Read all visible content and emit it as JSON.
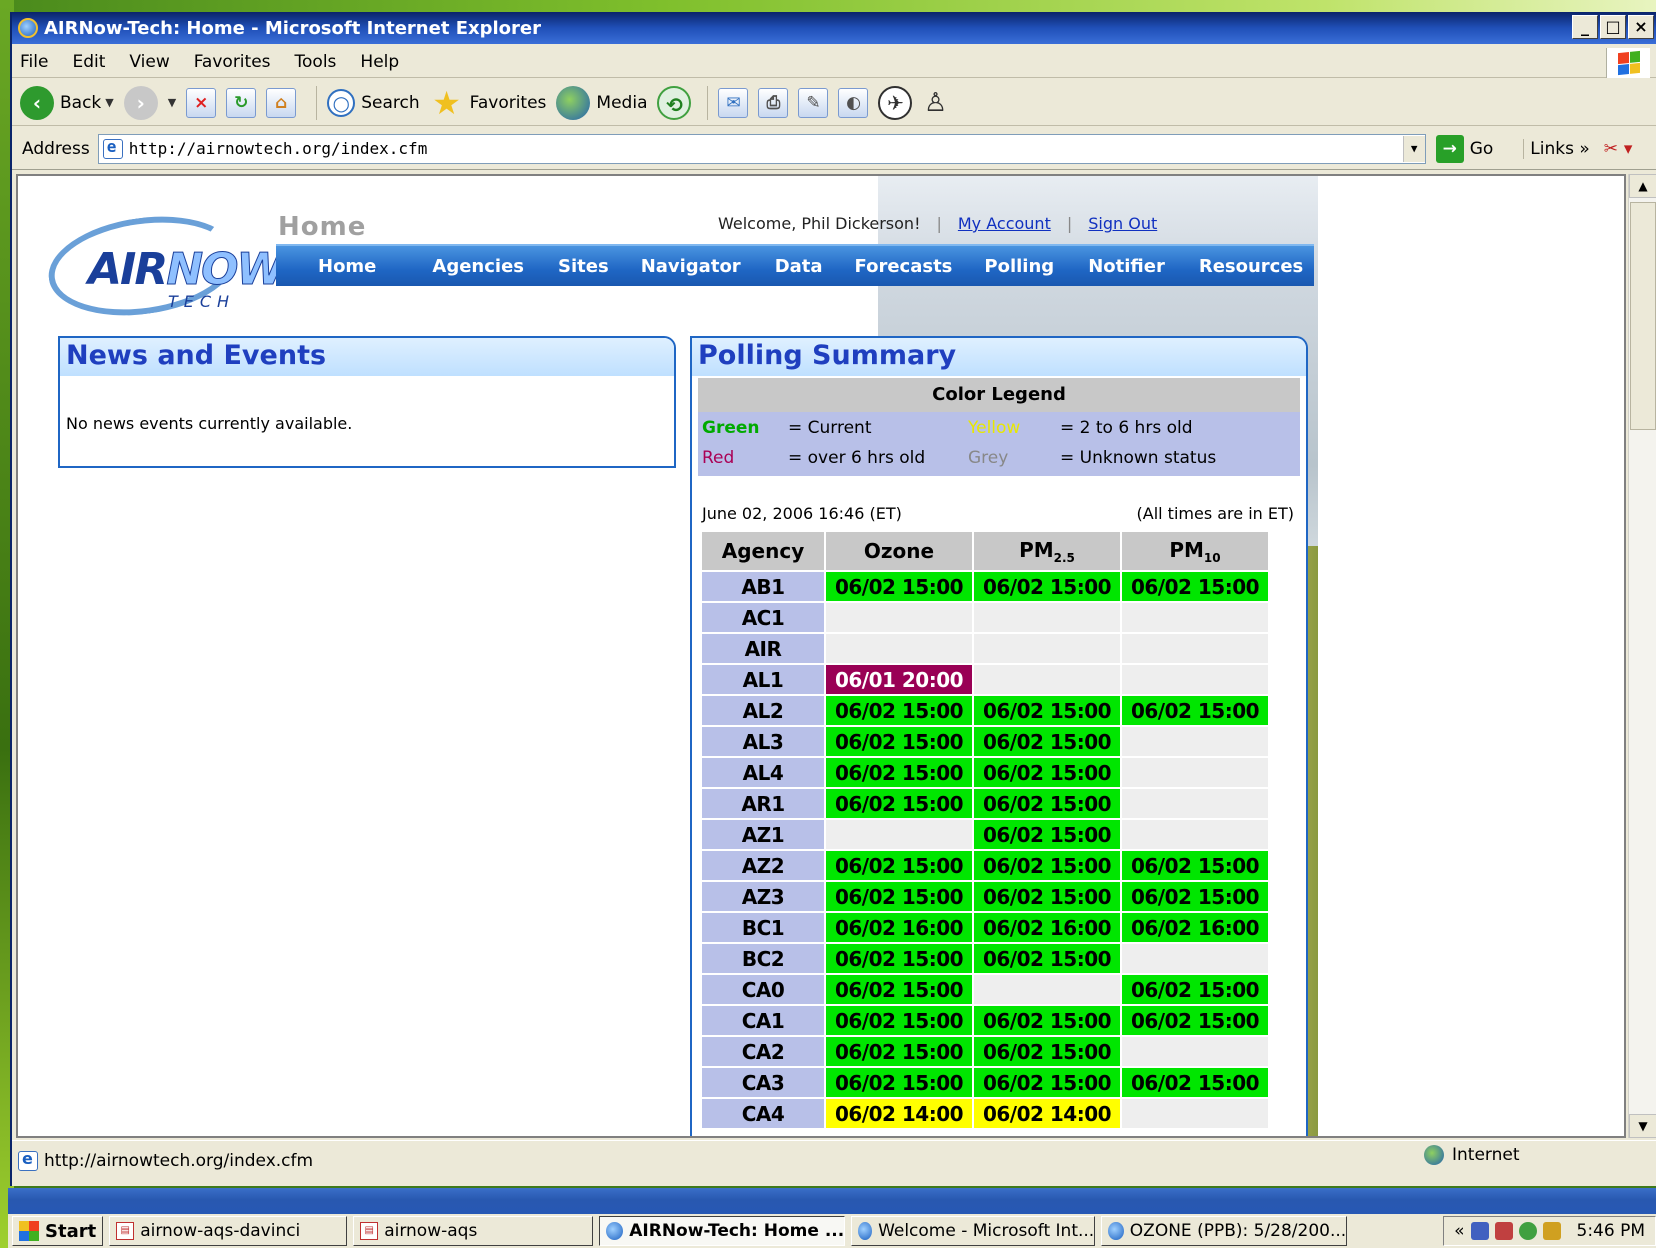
{
  "window": {
    "title": "AIRNow-Tech: Home - Microsoft Internet Explorer",
    "buttons": [
      "_",
      "□",
      "×"
    ]
  },
  "menubar": {
    "items": [
      "File",
      "Edit",
      "View",
      "Favorites",
      "Tools",
      "Help"
    ]
  },
  "toolbar": {
    "back": "Back",
    "search": "Search",
    "favorites": "Favorites",
    "media": "Media"
  },
  "address": {
    "label": "Address",
    "url": "http://airnowtech.org/index.cfm",
    "go": "Go",
    "links": "Links"
  },
  "logo": {
    "air": "AIR",
    "now": "NOW",
    "tech": "TECH"
  },
  "page": {
    "title": "Home",
    "welcome": "Welcome, Phil Dickerson!",
    "my_account": "My Account",
    "sign_out": "Sign Out",
    "sep": "|",
    "nav": [
      "Home",
      "Agencies",
      "Sites",
      "Navigator",
      "Data",
      "Forecasts",
      "Polling",
      "Notifier",
      "Resources"
    ]
  },
  "news": {
    "title": "News and Events",
    "text": "No news events currently available."
  },
  "polling": {
    "title": "Polling Summary",
    "legend_title": "Color Legend",
    "legend": [
      {
        "name": "Green",
        "desc": "= Current",
        "color": "#00aa00"
      },
      {
        "name": "Yellow",
        "desc": "= 2 to 6 hrs old",
        "color": "#e8e800"
      },
      {
        "name": "Red",
        "desc": "= over 6 hrs old",
        "color": "#aa0055"
      },
      {
        "name": "Grey",
        "desc": "= Unknown status",
        "color": "#888888"
      }
    ],
    "timestamp": "June 02, 2006 16:46 (ET)",
    "tz_note": "(All times are in ET)",
    "headers": {
      "agency": "Agency",
      "ozone": "Ozone",
      "pm25": "PM",
      "pm25_sub": "2.5",
      "pm10": "PM",
      "pm10_sub": "10"
    },
    "rows": [
      {
        "agency": "AB1",
        "ozone": "06/02 15:00",
        "ozone_s": "green",
        "pm25": "06/02 15:00",
        "pm25_s": "green",
        "pm10": "06/02 15:00",
        "pm10_s": "green"
      },
      {
        "agency": "AC1",
        "ozone": "",
        "ozone_s": "empty",
        "pm25": "",
        "pm25_s": "empty",
        "pm10": "",
        "pm10_s": "empty"
      },
      {
        "agency": "AIR",
        "ozone": "",
        "ozone_s": "empty",
        "pm25": "",
        "pm25_s": "empty",
        "pm10": "",
        "pm10_s": "empty"
      },
      {
        "agency": "AL1",
        "ozone": "06/01 20:00",
        "ozone_s": "red",
        "pm25": "",
        "pm25_s": "empty",
        "pm10": "",
        "pm10_s": "empty"
      },
      {
        "agency": "AL2",
        "ozone": "06/02 15:00",
        "ozone_s": "green",
        "pm25": "06/02 15:00",
        "pm25_s": "green",
        "pm10": "06/02 15:00",
        "pm10_s": "green"
      },
      {
        "agency": "AL3",
        "ozone": "06/02 15:00",
        "ozone_s": "green",
        "pm25": "06/02 15:00",
        "pm25_s": "green",
        "pm10": "",
        "pm10_s": "empty"
      },
      {
        "agency": "AL4",
        "ozone": "06/02 15:00",
        "ozone_s": "green",
        "pm25": "06/02 15:00",
        "pm25_s": "green",
        "pm10": "",
        "pm10_s": "empty"
      },
      {
        "agency": "AR1",
        "ozone": "06/02 15:00",
        "ozone_s": "green",
        "pm25": "06/02 15:00",
        "pm25_s": "green",
        "pm10": "",
        "pm10_s": "empty"
      },
      {
        "agency": "AZ1",
        "ozone": "",
        "ozone_s": "empty",
        "pm25": "06/02 15:00",
        "pm25_s": "green",
        "pm10": "",
        "pm10_s": "empty"
      },
      {
        "agency": "AZ2",
        "ozone": "06/02 15:00",
        "ozone_s": "green",
        "pm25": "06/02 15:00",
        "pm25_s": "green",
        "pm10": "06/02 15:00",
        "pm10_s": "green"
      },
      {
        "agency": "AZ3",
        "ozone": "06/02 15:00",
        "ozone_s": "green",
        "pm25": "06/02 15:00",
        "pm25_s": "green",
        "pm10": "06/02 15:00",
        "pm10_s": "green"
      },
      {
        "agency": "BC1",
        "ozone": "06/02 16:00",
        "ozone_s": "green",
        "pm25": "06/02 16:00",
        "pm25_s": "green",
        "pm10": "06/02 16:00",
        "pm10_s": "green"
      },
      {
        "agency": "BC2",
        "ozone": "06/02 15:00",
        "ozone_s": "green",
        "pm25": "06/02 15:00",
        "pm25_s": "green",
        "pm10": "",
        "pm10_s": "empty"
      },
      {
        "agency": "CA0",
        "ozone": "06/02 15:00",
        "ozone_s": "green",
        "pm25": "",
        "pm25_s": "empty",
        "pm10": "06/02 15:00",
        "pm10_s": "green"
      },
      {
        "agency": "CA1",
        "ozone": "06/02 15:00",
        "ozone_s": "green",
        "pm25": "06/02 15:00",
        "pm25_s": "green",
        "pm10": "06/02 15:00",
        "pm10_s": "green"
      },
      {
        "agency": "CA2",
        "ozone": "06/02 15:00",
        "ozone_s": "green",
        "pm25": "06/02 15:00",
        "pm25_s": "green",
        "pm10": "",
        "pm10_s": "empty"
      },
      {
        "agency": "CA3",
        "ozone": "06/02 15:00",
        "ozone_s": "green",
        "pm25": "06/02 15:00",
        "pm25_s": "green",
        "pm10": "06/02 15:00",
        "pm10_s": "green"
      },
      {
        "agency": "CA4",
        "ozone": "06/02 14:00",
        "ozone_s": "yellow",
        "pm25": "06/02 14:00",
        "pm25_s": "yellow",
        "pm10": "",
        "pm10_s": "empty"
      }
    ]
  },
  "statusbar": {
    "url": "http://airnowtech.org/index.cfm",
    "zone": "Internet"
  },
  "taskbar": {
    "start": "Start",
    "tasks": [
      {
        "label": "airnow-aqs-davinci",
        "icon": "doc"
      },
      {
        "label": "airnow-aqs",
        "icon": "doc"
      },
      {
        "label": "AIRNow-Tech: Home ...",
        "icon": "ie",
        "active": true
      },
      {
        "label": "Welcome - Microsoft Int...",
        "icon": "ie"
      },
      {
        "label": "OZONE (PPB): 5/28/200...",
        "icon": "ie"
      }
    ],
    "tray_chevron": "«",
    "clock": "5:46 PM"
  }
}
